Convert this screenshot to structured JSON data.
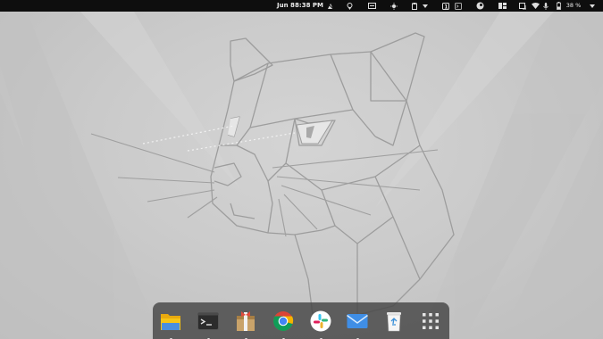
{
  "topbar": {
    "date": "Jun 8",
    "time": "8:38 PM",
    "battery_percent": "38 %",
    "icons": [
      "activities-icon",
      "location-icon",
      "screen-recorder-icon",
      "weather-icon",
      "clipboard-icon",
      "dropdown-arrow-icon",
      "bracket-icon",
      "terminal-icon",
      "steam-icon",
      "window-layout-icon",
      "screenshot-icon",
      "wifi-icon",
      "microphone-icon",
      "battery-icon",
      "system-menu-arrow-icon"
    ]
  },
  "dock": {
    "apps": [
      {
        "name": "Files",
        "icon": "folder-icon",
        "running": true
      },
      {
        "name": "Terminal",
        "icon": "terminal-icon",
        "running": true
      },
      {
        "name": "Archive Manager",
        "icon": "archive-icon",
        "running": true
      },
      {
        "name": "Google Chrome",
        "icon": "chrome-icon",
        "running": true
      },
      {
        "name": "Slack",
        "icon": "slack-icon",
        "running": true
      },
      {
        "name": "Mail",
        "icon": "mail-icon",
        "running": true
      },
      {
        "name": "Trash",
        "icon": "trash-icon",
        "running": false
      },
      {
        "name": "Show Applications",
        "icon": "app-grid-icon",
        "running": false
      }
    ]
  },
  "colors": {
    "topbar_bg": "#0e0e0e",
    "dock_bg": "#464646",
    "wallpaper": "#c8c8c8"
  }
}
